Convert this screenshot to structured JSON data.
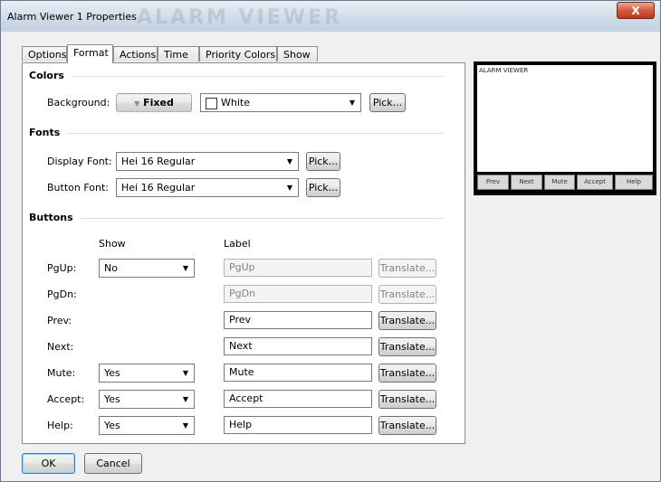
{
  "window": {
    "title": "Alarm Viewer 1 Properties",
    "ghost_title": "ALARM VIEWER",
    "close_label": "X"
  },
  "tabs": [
    "Options",
    "Format",
    "Actions",
    "Time",
    "Priority Colors",
    "Show"
  ],
  "active_tab": "Format",
  "colors": {
    "heading": "Colors",
    "background_label": "Background:",
    "background_mode": "Fixed",
    "background_mode_arrow": "▼",
    "background_color_name": "White",
    "background_color_value": "#ffffff",
    "pick_label": "Pick..."
  },
  "fonts": {
    "heading": "Fonts",
    "display_label": "Display Font:",
    "display_value": "Hei 16 Regular",
    "button_label": "Button Font:",
    "button_value": "Hei 16 Regular",
    "pick_label": "Pick..."
  },
  "buttons_section": {
    "heading": "Buttons",
    "show_header": "Show",
    "label_header": "Label",
    "translate_label": "Translate...",
    "rows": [
      {
        "name": "PgUp:",
        "show": "No",
        "label": "PgUp"
      },
      {
        "name": "PgDn:",
        "show": "",
        "label": "PgDn"
      },
      {
        "name": "Prev:",
        "show": "",
        "label": "Prev"
      },
      {
        "name": "Next:",
        "show": "",
        "label": "Next"
      },
      {
        "name": "Mute:",
        "show": "Yes",
        "label": "Mute"
      },
      {
        "name": "Accept:",
        "show": "Yes",
        "label": "Accept"
      },
      {
        "name": "Help:",
        "show": "Yes",
        "label": "Help"
      }
    ]
  },
  "preview": {
    "title": "ALARM VIEWER",
    "buttons": [
      "Prev",
      "Next",
      "Mute",
      "Accept",
      "Help"
    ]
  },
  "footer": {
    "ok_label": "OK",
    "cancel_label": "Cancel"
  },
  "icons": {
    "dropdown": "chevron-down-icon",
    "close": "close-icon"
  }
}
